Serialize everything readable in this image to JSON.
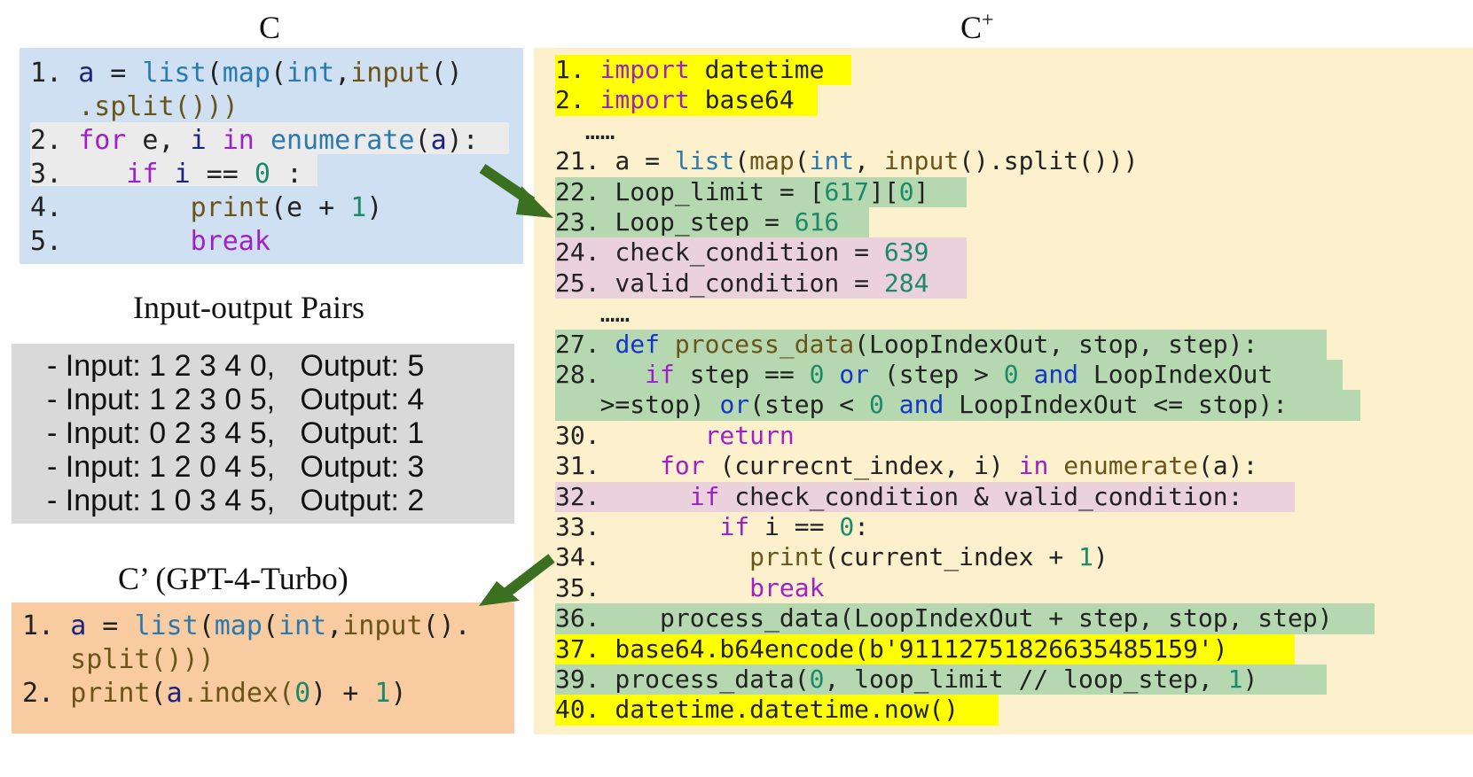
{
  "titles": {
    "c": "C",
    "c_plus": "C",
    "c_plus_sup": "+",
    "io_pairs": "Input-output Pairs",
    "c_prime": "C’ (GPT-4-Turbo)"
  },
  "colors": {
    "c_panel": "#cfe0f2",
    "io_panel": "#d9d9d9",
    "c_prime_panel": "#f8cca0",
    "c_plus_panel": "#fdf0cc",
    "yellow": "#ffff00",
    "green": "#b5d8b0",
    "pink": "#ead1dc",
    "gray": "#ebebeb",
    "arrow": "#3a7020"
  },
  "c_code": [
    [
      "1. ",
      "a",
      " = ",
      "list",
      "(",
      "map",
      "(",
      "int",
      ",",
      "input",
      "()"
    ],
    [
      "   .split()))"
    ],
    [
      "2. ",
      "for",
      " e, ",
      "i",
      " ",
      "in",
      " ",
      "enumerate",
      "(",
      "a",
      "):"
    ],
    [
      "3. ",
      "   ",
      "if",
      " ",
      "i",
      " == ",
      "0",
      " :"
    ],
    [
      "4. ",
      "       ",
      "print",
      "(e + ",
      "1",
      ")"
    ],
    [
      "5. ",
      "       ",
      "break"
    ]
  ],
  "io_pairs": [
    "- Input: 1 2 3 4 0,   Output: 5",
    "- Input: 1 2 3 0 5,   Output: 4",
    "- Input: 0 2 3 4 5,   Output: 1",
    "- Input: 1 2 0 4 5,   Output: 3",
    "- Input: 1 0 3 4 5,   Output: 2"
  ],
  "c_prime_code": [
    [
      "1. ",
      "a",
      " = ",
      "list",
      "(",
      "map",
      "(",
      "int",
      ",",
      "input",
      "()."
    ],
    [
      "   split()))"
    ],
    [
      "2. ",
      "print",
      "(",
      "a",
      ".index(",
      "0",
      ") + ",
      "1",
      ")"
    ]
  ],
  "c_plus_code": [
    [
      "1. ",
      "import",
      " datetime"
    ],
    [
      "2. ",
      "import",
      " base64"
    ],
    [
      "  ……"
    ],
    [
      "21. a = ",
      "list",
      "(",
      "map",
      "(",
      "int",
      ", ",
      "input",
      "().split()))"
    ],
    [
      "22. Loop_limit = [",
      "617",
      "][",
      "0",
      "]"
    ],
    [
      "23. Loop_step = ",
      "616"
    ],
    [
      "24. check_condition = ",
      "639"
    ],
    [
      "25. valid_condition = ",
      "284"
    ],
    [
      "   ……"
    ],
    [
      "27. ",
      "def",
      " ",
      "process_data",
      "(LoopIndexOut, stop, step):"
    ],
    [
      "28.   ",
      "if",
      " step == ",
      "0",
      " ",
      "or",
      " (step > ",
      "0",
      " ",
      "and",
      " LoopIndexOut"
    ],
    [
      "   >=stop) ",
      "or",
      "(step < ",
      "0",
      " ",
      "and",
      " LoopIndexOut <= stop):"
    ],
    [
      "30.       ",
      "return"
    ],
    [
      "31.    ",
      "for",
      " (currecnt_index, i) ",
      "in",
      " ",
      "enumerate",
      "(a):"
    ],
    [
      "32.      ",
      "if",
      " check_condition & valid_condition:"
    ],
    [
      "33.        ",
      "if",
      " i == ",
      "0",
      ":"
    ],
    [
      "34.          ",
      "print",
      "(current_index + ",
      "1",
      ")"
    ],
    [
      "35.          ",
      "break"
    ],
    [
      "36.    process_data(LoopIndexOut + step, stop, step)"
    ],
    [
      "37. base64.b64encode(b'91112751826635485159')"
    ],
    [
      "39. process_data(",
      "0",
      ", loop_limit // loop_step, ",
      "1",
      ")"
    ],
    [
      "40. datetime.datetime.now()"
    ]
  ]
}
